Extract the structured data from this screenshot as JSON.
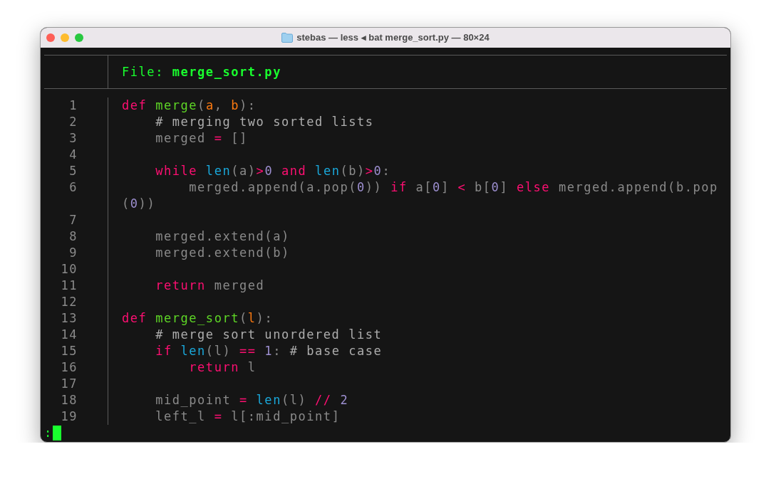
{
  "window": {
    "title": "stebas — less ◂ bat merge_sort.py — 80×24"
  },
  "header": {
    "text": "File: **merge_sort.py**"
  },
  "rows": [
    {
      "number": "1",
      "tokens": [
        {
          "kind": "kw",
          "text": "def"
        },
        {
          "kind": "fn",
          "text": " merge"
        },
        {
          "kind": "plain",
          "text": "("
        },
        {
          "kind": "param",
          "text": "a"
        },
        {
          "kind": "plain",
          "text": ", "
        },
        {
          "kind": "param",
          "text": "b"
        },
        {
          "kind": "plain",
          "text": "):"
        }
      ]
    },
    {
      "number": "2",
      "tokens": [
        {
          "kind": "comment",
          "text": "    # merging two sorted lists"
        }
      ]
    },
    {
      "number": "3",
      "tokens": [
        {
          "kind": "plain",
          "text": "    merged "
        },
        {
          "kind": "op",
          "text": "="
        },
        {
          "kind": "plain",
          "text": " []"
        }
      ]
    },
    {
      "number": "4",
      "tokens": []
    },
    {
      "number": "5",
      "tokens": [
        {
          "kind": "kw",
          "text": "    while"
        },
        {
          "kind": "builtin",
          "text": " len"
        },
        {
          "kind": "plain",
          "text": "(a)"
        },
        {
          "kind": "op",
          "text": ">"
        },
        {
          "kind": "num",
          "text": "0"
        },
        {
          "kind": "kw",
          "text": " and"
        },
        {
          "kind": "builtin",
          "text": " len"
        },
        {
          "kind": "plain",
          "text": "(b)"
        },
        {
          "kind": "op",
          "text": ">"
        },
        {
          "kind": "num",
          "text": "0"
        },
        {
          "kind": "plain",
          "text": ":"
        }
      ]
    },
    {
      "number": "6",
      "tokens": [
        {
          "kind": "plain",
          "text": "        merged.append(a.pop("
        },
        {
          "kind": "num",
          "text": "0"
        },
        {
          "kind": "plain",
          "text": ")) "
        },
        {
          "kind": "kw",
          "text": "if"
        },
        {
          "kind": "plain",
          "text": " a["
        },
        {
          "kind": "num",
          "text": "0"
        },
        {
          "kind": "plain",
          "text": "] "
        },
        {
          "kind": "op",
          "text": "<"
        },
        {
          "kind": "plain",
          "text": " b["
        },
        {
          "kind": "num",
          "text": "0"
        },
        {
          "kind": "plain",
          "text": "] "
        },
        {
          "kind": "kw",
          "text": "else"
        },
        {
          "kind": "plain",
          "text": " merged.append(b.pop"
        }
      ]
    },
    {
      "tokens": [
        {
          "kind": "plain",
          "text": "("
        },
        {
          "kind": "num",
          "text": "0"
        },
        {
          "kind": "plain",
          "text": "))"
        }
      ]
    },
    {
      "number": "7",
      "tokens": []
    },
    {
      "number": "8",
      "tokens": [
        {
          "kind": "plain",
          "text": "    merged.extend(a)"
        }
      ]
    },
    {
      "number": "9",
      "tokens": [
        {
          "kind": "plain",
          "text": "    merged.extend(b)"
        }
      ]
    },
    {
      "number": "10",
      "tokens": []
    },
    {
      "number": "11",
      "tokens": [
        {
          "kind": "kw",
          "text": "    return"
        },
        {
          "kind": "plain",
          "text": " merged"
        }
      ]
    },
    {
      "number": "12",
      "tokens": []
    },
    {
      "number": "13",
      "tokens": [
        {
          "kind": "kw",
          "text": "def"
        },
        {
          "kind": "fn",
          "text": " merge_sort"
        },
        {
          "kind": "plain",
          "text": "("
        },
        {
          "kind": "param",
          "text": "l"
        },
        {
          "kind": "plain",
          "text": "):"
        }
      ]
    },
    {
      "number": "14",
      "tokens": [
        {
          "kind": "comment",
          "text": "    # merge sort unordered list"
        }
      ]
    },
    {
      "number": "15",
      "tokens": [
        {
          "kind": "kw",
          "text": "    if"
        },
        {
          "kind": "builtin",
          "text": " len"
        },
        {
          "kind": "plain",
          "text": "(l) "
        },
        {
          "kind": "op",
          "text": "=="
        },
        {
          "kind": "num",
          "text": " 1"
        },
        {
          "kind": "plain",
          "text": ":"
        },
        {
          "kind": "comment",
          "text": " # base case"
        }
      ]
    },
    {
      "number": "16",
      "tokens": [
        {
          "kind": "kw",
          "text": "        return"
        },
        {
          "kind": "plain",
          "text": " l"
        }
      ]
    },
    {
      "number": "17",
      "tokens": []
    },
    {
      "number": "18",
      "tokens": [
        {
          "kind": "plain",
          "text": "    mid_point "
        },
        {
          "kind": "op",
          "text": "="
        },
        {
          "kind": "builtin",
          "text": " len"
        },
        {
          "kind": "plain",
          "text": "(l) "
        },
        {
          "kind": "op",
          "text": "//"
        },
        {
          "kind": "num",
          "text": " 2"
        }
      ]
    },
    {
      "number": "19",
      "tokens": [
        {
          "kind": "plain",
          "text": "    left_l "
        },
        {
          "kind": "op",
          "text": "="
        },
        {
          "kind": "plain",
          "text": " l[:mid_point]"
        }
      ]
    }
  ],
  "prompt": {
    "text": ":"
  }
}
